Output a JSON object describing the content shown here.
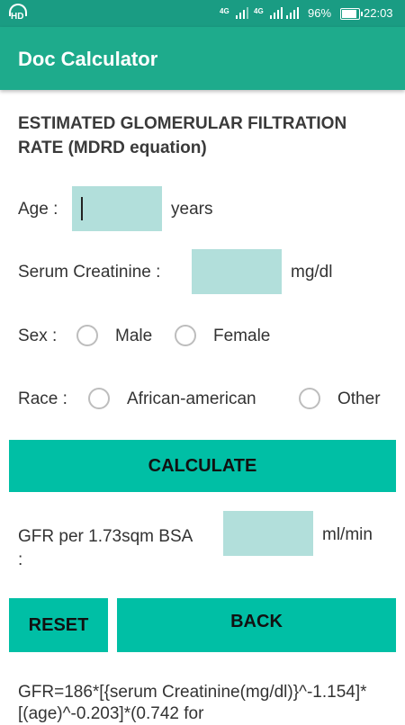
{
  "status_bar": {
    "hd": "HD",
    "signal_1": "4G",
    "signal_2": "4G",
    "battery": "96%",
    "time": "22:03",
    "battery_level": 0.96
  },
  "app_bar": {
    "title": "Doc Calculator"
  },
  "heading": "ESTIMATED GLOMERULAR FILTRATION RATE (MDRD equation)",
  "age": {
    "label": "Age :",
    "value": "",
    "unit": "years"
  },
  "creatinine": {
    "label": "Serum Creatinine :",
    "value": "",
    "unit": "mg/dl"
  },
  "sex": {
    "label": "Sex :",
    "options": [
      "Male",
      "Female"
    ]
  },
  "race": {
    "label": "Race :",
    "options": [
      "African-american",
      "Other"
    ]
  },
  "buttons": {
    "calculate": "CALCULATE",
    "reset": "RESET",
    "back": "BACK"
  },
  "result": {
    "label": "GFR per 1.73sqm BSA :",
    "value": "",
    "unit": "ml/min"
  },
  "formula": "GFR=186*[{serum Creatinine(mg/dl)}^-1.154]*[(age)^-0.203]*(0.742 for"
}
